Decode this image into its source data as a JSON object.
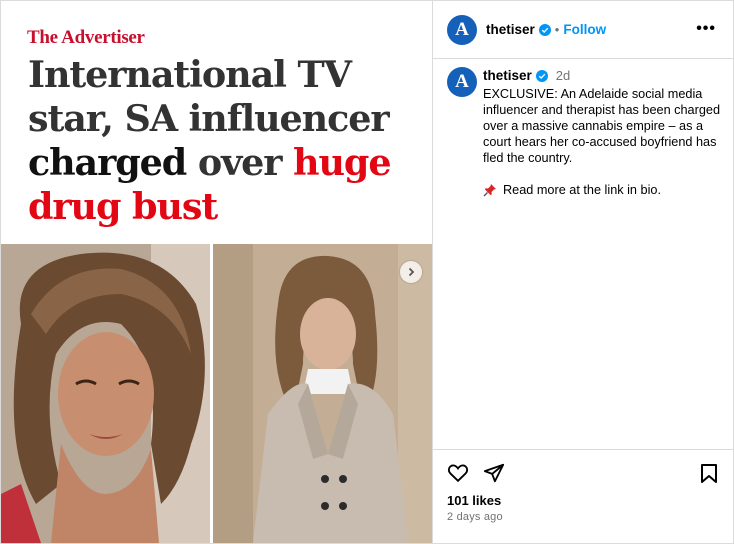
{
  "post_image": {
    "masthead": "The Advertiser",
    "headline": {
      "part1": "International TV star, SA influencer",
      "part2": "charged",
      "part3": "over",
      "part4": "huge drug bust"
    }
  },
  "header": {
    "avatar_letter": "A",
    "username": "thetiser",
    "separator": "•",
    "follow_label": "Follow",
    "more_label": "•••"
  },
  "caption": {
    "avatar_letter": "A",
    "username": "thetiser",
    "time_ago": "2d",
    "text": "EXCLUSIVE: An Adelaide social media influencer and therapist has been charged over a massive cannabis empire – as a court hears her co-accused boyfriend has fled the country.",
    "read_more": "Read more at the link in bio."
  },
  "footer": {
    "likes": "101 likes",
    "posted": "2 days ago"
  },
  "colors": {
    "brand_red": "#c8102e",
    "headline_red": "#e30613",
    "avatar_blue": "#1560b8",
    "follow_blue": "#0095f6",
    "border": "#dbdbdb"
  },
  "icons": [
    "verified-badge-icon",
    "more-options-icon",
    "heart-icon",
    "share-icon",
    "bookmark-icon",
    "pushpin-icon",
    "chevron-right-icon"
  ]
}
